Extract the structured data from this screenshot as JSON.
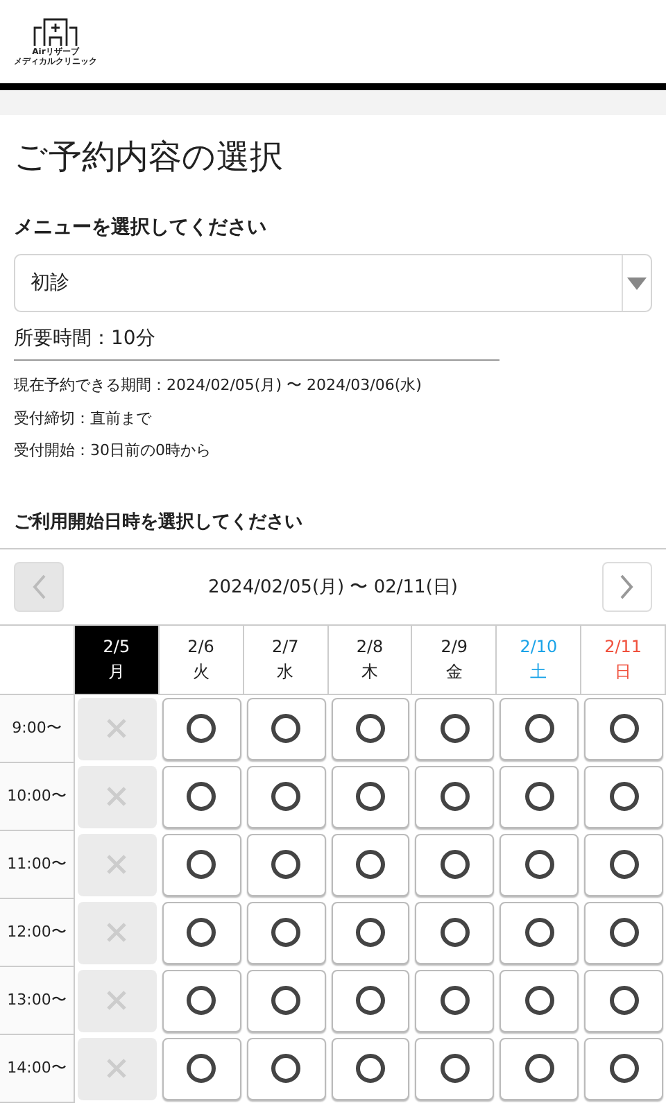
{
  "logo": {
    "line1": "Airリザーブ",
    "line2": "メディカルクリニック"
  },
  "title": "ご予約内容の選択",
  "menu": {
    "label": "メニューを選択してください",
    "value": "初診"
  },
  "duration": "所要時間：10分",
  "info": [
    "現在予約できる期間：2024/02/05(月) 〜 2024/03/06(水)",
    "受付締切：直前まで",
    "受付開始：30日前の0時から"
  ],
  "date_heading": "ご利用開始日時を選択してください",
  "week": {
    "range": "2024/02/05(月) 〜 02/11(日)",
    "prev_disabled": true,
    "next_disabled": false
  },
  "days": [
    {
      "date": "2/5",
      "weekday": "月",
      "kind": "weekday",
      "selected": true
    },
    {
      "date": "2/6",
      "weekday": "火",
      "kind": "weekday",
      "selected": false
    },
    {
      "date": "2/7",
      "weekday": "水",
      "kind": "weekday",
      "selected": false
    },
    {
      "date": "2/8",
      "weekday": "木",
      "kind": "weekday",
      "selected": false
    },
    {
      "date": "2/9",
      "weekday": "金",
      "kind": "weekday",
      "selected": false
    },
    {
      "date": "2/10",
      "weekday": "土",
      "kind": "saturday",
      "selected": false
    },
    {
      "date": "2/11",
      "weekday": "日",
      "kind": "sunday",
      "selected": false
    }
  ],
  "slots": [
    {
      "time": "9:00〜",
      "available": [
        false,
        true,
        true,
        true,
        true,
        true,
        true
      ]
    },
    {
      "time": "10:00〜",
      "available": [
        false,
        true,
        true,
        true,
        true,
        true,
        true
      ]
    },
    {
      "time": "11:00〜",
      "available": [
        false,
        true,
        true,
        true,
        true,
        true,
        true
      ]
    },
    {
      "time": "12:00〜",
      "available": [
        false,
        true,
        true,
        true,
        true,
        true,
        true
      ]
    },
    {
      "time": "13:00〜",
      "available": [
        false,
        true,
        true,
        true,
        true,
        true,
        true
      ]
    },
    {
      "time": "14:00〜",
      "available": [
        false,
        true,
        true,
        true,
        true,
        true,
        true
      ]
    }
  ]
}
